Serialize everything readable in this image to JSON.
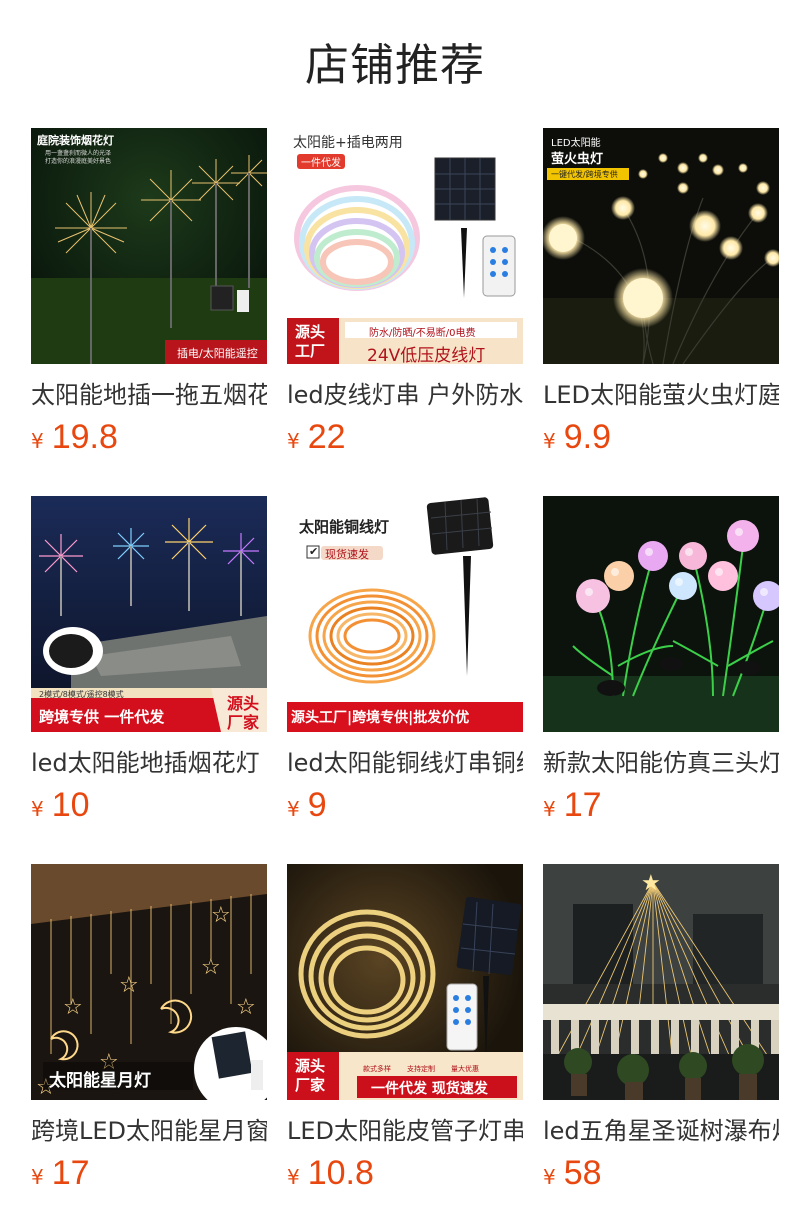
{
  "header": {
    "title": "店铺推荐"
  },
  "products": [
    {
      "name": "太阳能地插一拖五烟花灯",
      "price": "19.8",
      "image_text": [
        "庭院装饰烟花灯",
        "用一盏盏刹而微人的光泽",
        "打造你的浪漫庭美好景色",
        "插电/太阳能遥控"
      ]
    },
    {
      "name": "led皮线灯串 户外防水",
      "price": "22",
      "image_text": [
        "太阳能+插电两用",
        "一件代发",
        "源头",
        "工厂",
        "防水/防晒/不易断/0电费",
        "24V低压皮线灯"
      ]
    },
    {
      "name": "LED太阳能萤火虫灯庭院",
      "price": "9.9",
      "image_text": [
        "LED太阳能",
        "萤火虫灯",
        "一键代发/跨境专供"
      ]
    },
    {
      "name": "led太阳能地插烟花灯",
      "price": "10",
      "image_text": [
        "2模式/8模式/遥控8模式",
        "跨境专供 一件代发",
        "源头",
        "厂家"
      ]
    },
    {
      "name": "led太阳能铜线灯串铜线",
      "price": "9",
      "image_text": [
        "太阳能铜线灯",
        "现货速发",
        "源头工厂|跨境专供|批发价优"
      ]
    },
    {
      "name": "新款太阳能仿真三头灯",
      "price": "17",
      "image_text": []
    },
    {
      "name": "跨境LED太阳能星月窗帘灯",
      "price": "17",
      "image_text": [
        "太阳能星月灯"
      ]
    },
    {
      "name": "LED太阳能皮管子灯串",
      "price": "10.8",
      "image_text": [
        "源头",
        "厂家",
        "款式多样",
        "支持定制",
        "量大优惠",
        "一件代发 现货速发"
      ]
    },
    {
      "name": "led五角星圣诞树瀑布灯",
      "price": "58",
      "image_text": []
    }
  ],
  "currency_symbol": "¥",
  "colors": {
    "price": "#e8480f",
    "title": "#222222",
    "text": "#333333"
  }
}
